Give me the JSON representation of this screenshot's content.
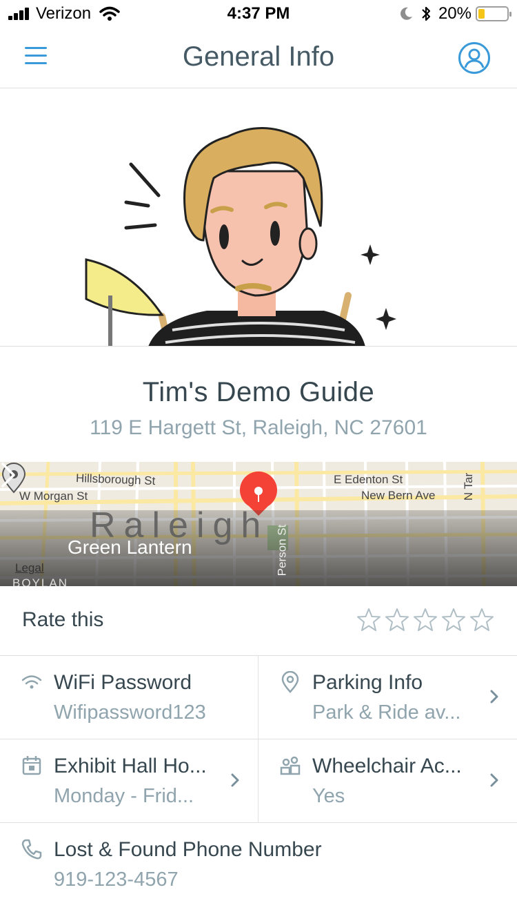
{
  "status_bar": {
    "carrier": "Verizon",
    "time": "4:37 PM",
    "battery": "20%",
    "battery_level": 0.2
  },
  "nav": {
    "title": "General Info",
    "menu_icon": "hamburger-menu-icon",
    "profile_icon": "user-profile-icon"
  },
  "guide": {
    "title": "Tim's Demo Guide",
    "address": "119 E Hargett St, Raleigh, NC 27601"
  },
  "map": {
    "city": "Raleigh",
    "place": "Green Lantern",
    "legal": "Legal",
    "streets": [
      "Hillsborough St",
      "W Morgan St",
      "E Edenton St",
      "New Bern Ave",
      "N Tar",
      "Person St",
      "BOYLAN"
    ],
    "pin_color": "#f44336"
  },
  "rating": {
    "label": "Rate this",
    "max": 5,
    "value": 0
  },
  "info": {
    "wifi": {
      "title": "WiFi Password",
      "value": "Wifipassword123",
      "icon": "wifi-icon"
    },
    "parking": {
      "title": "Parking Info",
      "value": "Park & Ride av...",
      "icon": "location-pin-icon"
    },
    "exhibit": {
      "title": "Exhibit Hall Ho...",
      "value": "Monday - Frid...",
      "icon": "calendar-icon"
    },
    "wheelchair": {
      "title": "Wheelchair Ac...",
      "value": "Yes",
      "icon": "people-icon"
    },
    "lostfound": {
      "title": "Lost & Found Phone Number",
      "value": "919-123-4567",
      "icon": "phone-icon"
    }
  },
  "colors": {
    "accent": "#3a9ad9",
    "title_text": "#37474f",
    "secondary_text": "#90a4ae",
    "icon_gray": "#90a4ae"
  }
}
